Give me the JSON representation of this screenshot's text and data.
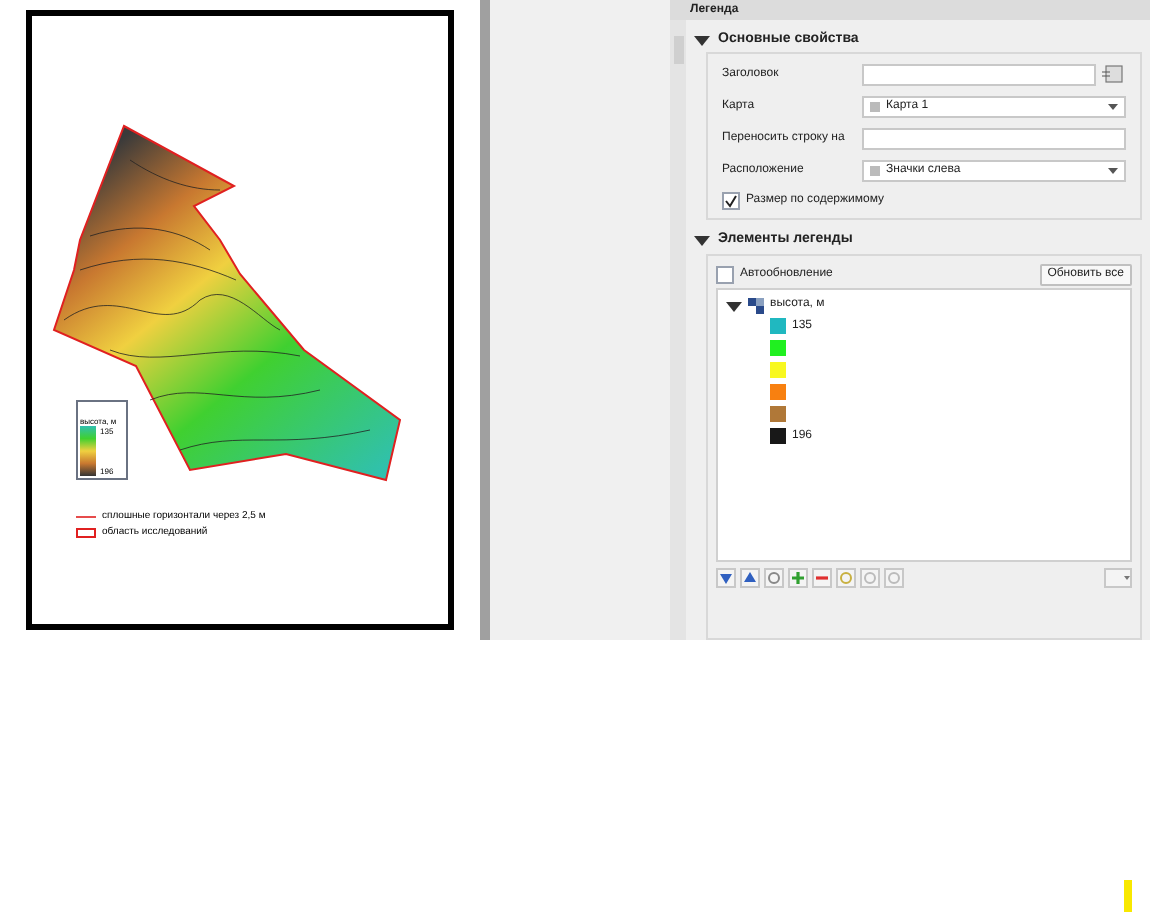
{
  "map": {
    "inset_legend": {
      "title": "высота, м",
      "min": "135",
      "max": "196"
    },
    "legend": [
      {
        "kind": "line",
        "label": "сплошные горизонтали через 2,5 м"
      },
      {
        "kind": "area",
        "label": "область исследований"
      }
    ]
  },
  "panel": {
    "title": "Легенда",
    "basic": {
      "title": "Основные свойства",
      "expanded": true,
      "fields": [
        {
          "kind": "text",
          "label": "Заголовок"
        },
        {
          "kind": "select",
          "label": "Карта",
          "value": "Карта 1"
        },
        {
          "kind": "text",
          "label": "Переносить строку на"
        },
        {
          "kind": "select",
          "label": "Расположение",
          "value": "Значки слева"
        }
      ],
      "autosize": {
        "label": "Размер по содержимому",
        "checked": true
      }
    },
    "items": {
      "title": "Элементы легенды",
      "expanded": true,
      "auto_update": {
        "label": "Автообновление",
        "checked": false
      },
      "update_button": "Обновить все",
      "tree": [
        {
          "label": "высота, м",
          "expanded": true,
          "children": [
            {
              "color": "#20b8c0",
              "label": "135"
            },
            {
              "color": "#20f020"
            },
            {
              "color": "#f8f820"
            },
            {
              "color": "#f88010"
            },
            {
              "color": "#b07838"
            },
            {
              "color": "#181818",
              "label": "196"
            }
          ]
        }
      ]
    }
  }
}
